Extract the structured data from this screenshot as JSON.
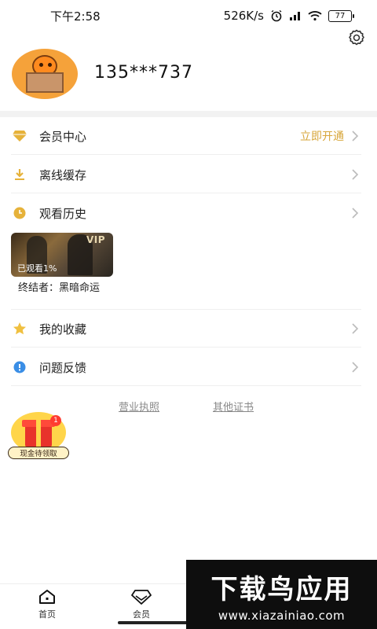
{
  "status_bar": {
    "time": "下午2:58",
    "speed": "526K/s",
    "battery": "77"
  },
  "header": {
    "phone": "135***737"
  },
  "menu": [
    {
      "label": "会员中心",
      "extra": "立即开通",
      "icon": "diamond-icon",
      "color": "#e6b23a"
    },
    {
      "label": "离线缓存",
      "icon": "download-icon",
      "color": "#e6b23a"
    },
    {
      "label": "观看历史",
      "icon": "clock-icon",
      "color": "#e6b23a"
    },
    {
      "label": "我的收藏",
      "icon": "star-icon",
      "color": "#f0c040"
    },
    {
      "label": "问题反馈",
      "icon": "info-icon",
      "color": "#3a8ee6"
    }
  ],
  "history": {
    "badge": "VIP",
    "watched": "已观看1%",
    "title": "终结者：黑暗命运"
  },
  "links": {
    "business_license": "营业执照",
    "other_certs": "其他证书"
  },
  "gift": {
    "count": "1",
    "label": "现金待领取"
  },
  "bottom_nav": [
    {
      "label": "首页",
      "icon": "home-icon"
    },
    {
      "label": "会员",
      "icon": "diamond-icon"
    }
  ],
  "watermark": {
    "title": "下载鸟应用",
    "url": "www.xiazainiao.com"
  }
}
